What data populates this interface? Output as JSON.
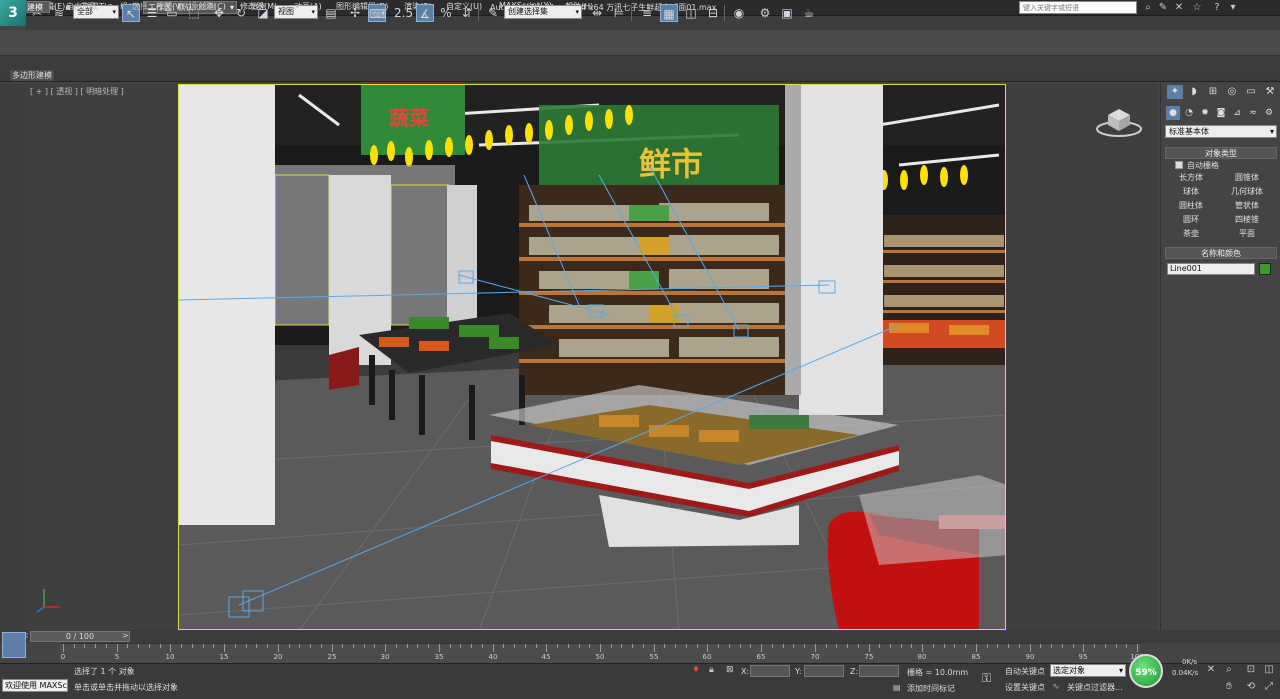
{
  "title_bar": {
    "workspace_label": "工作区: 默认",
    "app_title": "Autodesk 3ds Max  2014 x64     万讯七子生鲜超市减面01.max",
    "search_placeholder": "键入关键字或短语",
    "window_controls": [
      "help-icon",
      "close-icon",
      "star-icon",
      "info-icon"
    ]
  },
  "menu": [
    "编辑(E)",
    "工具(T)",
    "组(G)",
    "视图(V)",
    "创建(C)",
    "修改器(M)",
    "动画(A)",
    "图形编辑器(D)",
    "渲染(R)",
    "自定义(U)",
    "MAXScript(X)",
    "帮助(H)"
  ],
  "toolbar": {
    "selection_filter": "全部",
    "ref_coord": "视图",
    "named_selection": "创建选择集",
    "snap_value": "2.5"
  },
  "ribbon": {
    "tabs": [
      "建模",
      "自由形式",
      "选择",
      "对象绘制",
      "填充"
    ],
    "active_tab": "建模",
    "sub_label": "多边形建模"
  },
  "viewport": {
    "label": "[ + ] [ 透视 ] [ 明暗处理 ]"
  },
  "scene": {
    "banner_left_text": "蔬菜",
    "banner_right_text": "鲜市",
    "theme_colors": {
      "wall": "#1a1a1a",
      "pillar": "#e7e7e7",
      "floor": "#5a5a5a",
      "banner": "#2f8a3a",
      "lamp": "#ffe100",
      "freezer_trim": "#9d1a1a",
      "chair": "#c30f0f",
      "viewport_border": "#e6d84a"
    }
  },
  "command_panel": {
    "tabs": [
      "create-icon",
      "modify-icon",
      "hierarchy-icon",
      "motion-icon",
      "display-icon",
      "utilities-icon"
    ],
    "subtabs": [
      "geometry-icon",
      "shapes-icon",
      "lights-icon",
      "cameras-icon",
      "helpers-icon",
      "spacewarps-icon",
      "systems-icon"
    ],
    "dropdown": "标准基本体",
    "object_type_header": "对象类型",
    "autogrid_label": "自动栅格",
    "object_buttons": [
      "长方体",
      "圆锥体",
      "球体",
      "几何球体",
      "圆柱体",
      "管状体",
      "圆环",
      "四棱锥",
      "茶壶",
      "平面"
    ],
    "name_color_header": "名称和颜色",
    "object_name": "Line001",
    "object_color": "#3c9a2c"
  },
  "timeline": {
    "slider_label": "0 / 100",
    "ticks": [
      "0",
      "5",
      "10",
      "15",
      "20",
      "25",
      "30",
      "35",
      "40",
      "45",
      "50",
      "55",
      "60",
      "65",
      "70",
      "75",
      "80",
      "85",
      "90",
      "95",
      "100"
    ]
  },
  "status": {
    "welcome": "欢迎使用 MAXScri",
    "selected": "选择了 1 个 对象",
    "hint": "单击或单击并拖动以选择对象",
    "x_label": "X:",
    "y_label": "Y:",
    "z_label": "Z:",
    "grid": "栅格 = 10.0mm",
    "add_time_tag": "添加时间标记",
    "auto_key": "自动关键点",
    "set_key": "设置关键点",
    "selection_combo": "选定对象",
    "key_filters": "关键点过滤器..."
  },
  "network": {
    "percent": "59%",
    "up": "0K/s",
    "down": "0.04K/s"
  }
}
